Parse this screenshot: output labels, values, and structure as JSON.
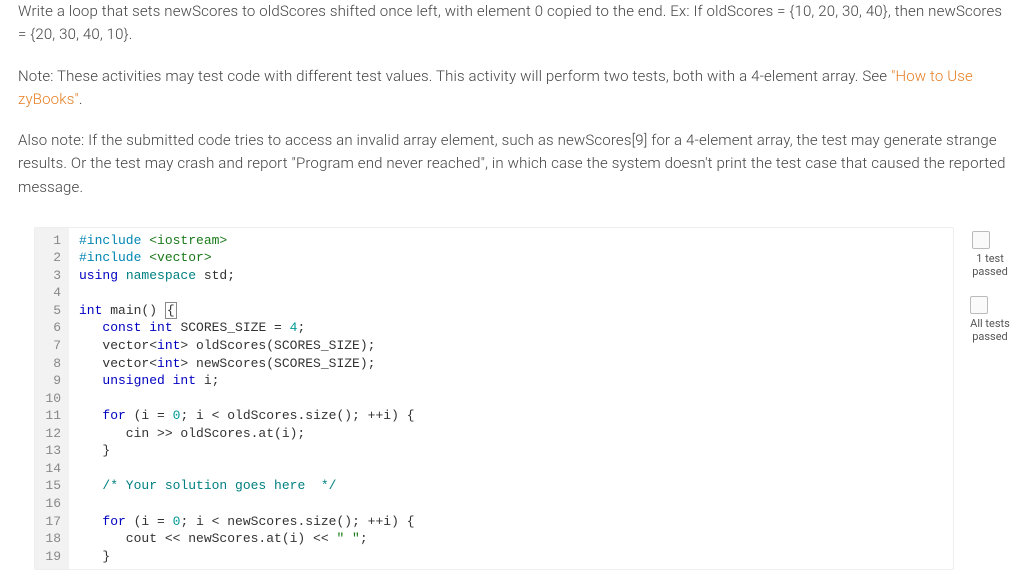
{
  "instructions": {
    "p1": "Write a loop that sets newScores to oldScores shifted once left, with element 0 copied to the end. Ex: If oldScores = {10, 20, 30, 40}, then newScores = {20, 30, 40, 10}.",
    "p2a": "Note: These activities may test code with different test values. This activity will perform two tests, both with a 4-element array. See ",
    "p2_link": "\"How to Use zyBooks\"",
    "p2b": ".",
    "p3": "Also note: If the submitted code tries to access an invalid array element, such as newScores[9] for a 4-element array, the test may generate strange results. Or the test may crash and report \"Program end never reached\", in which case the system doesn't print the test case that caused the reported message."
  },
  "code": {
    "lines": [
      {
        "n": 1,
        "tokens": [
          [
            "pp",
            "#include "
          ],
          [
            "str",
            "<iostream>"
          ]
        ]
      },
      {
        "n": 2,
        "tokens": [
          [
            "pp",
            "#include "
          ],
          [
            "str",
            "<vector>"
          ]
        ]
      },
      {
        "n": 3,
        "tokens": [
          [
            "kw",
            "using "
          ],
          [
            "ns",
            "namespace "
          ],
          [
            "id",
            "std;"
          ]
        ]
      },
      {
        "n": 4,
        "tokens": []
      },
      {
        "n": 5,
        "tokens": [
          [
            "type",
            "int "
          ],
          [
            "id",
            "main() "
          ],
          [
            "id",
            "{"
          ]
        ],
        "cursor_after_brace": true
      },
      {
        "n": 6,
        "tokens": [
          [
            "id",
            "   "
          ],
          [
            "kw",
            "const "
          ],
          [
            "type",
            "int "
          ],
          [
            "id",
            "SCORES_SIZE = "
          ],
          [
            "num",
            "4"
          ],
          [
            "id",
            ";"
          ]
        ]
      },
      {
        "n": 7,
        "tokens": [
          [
            "id",
            "   vector<"
          ],
          [
            "type",
            "int"
          ],
          [
            "id",
            "> oldScores(SCORES_SIZE);"
          ]
        ]
      },
      {
        "n": 8,
        "tokens": [
          [
            "id",
            "   vector<"
          ],
          [
            "type",
            "int"
          ],
          [
            "id",
            "> newScores(SCORES_SIZE);"
          ]
        ]
      },
      {
        "n": 9,
        "tokens": [
          [
            "id",
            "   "
          ],
          [
            "type",
            "unsigned int "
          ],
          [
            "id",
            "i;"
          ]
        ]
      },
      {
        "n": 10,
        "tokens": []
      },
      {
        "n": 11,
        "tokens": [
          [
            "id",
            "   "
          ],
          [
            "kw",
            "for "
          ],
          [
            "id",
            "(i = "
          ],
          [
            "num",
            "0"
          ],
          [
            "id",
            "; i < oldScores.size(); ++i) {"
          ]
        ]
      },
      {
        "n": 12,
        "tokens": [
          [
            "id",
            "      cin >> oldScores.at(i);"
          ]
        ]
      },
      {
        "n": 13,
        "tokens": [
          [
            "id",
            "   }"
          ]
        ]
      },
      {
        "n": 14,
        "tokens": []
      },
      {
        "n": 15,
        "tokens": [
          [
            "id",
            "   "
          ],
          [
            "cmt",
            "/* Your solution goes here  */"
          ]
        ]
      },
      {
        "n": 16,
        "tokens": []
      },
      {
        "n": 17,
        "tokens": [
          [
            "id",
            "   "
          ],
          [
            "kw",
            "for "
          ],
          [
            "id",
            "(i = "
          ],
          [
            "num",
            "0"
          ],
          [
            "id",
            "; i < newScores.size(); ++i) {"
          ]
        ]
      },
      {
        "n": 18,
        "tokens": [
          [
            "id",
            "      cout << newScores.at(i) << "
          ],
          [
            "str",
            "\" \""
          ],
          [
            "id",
            ";"
          ]
        ]
      },
      {
        "n": 19,
        "tokens": [
          [
            "id",
            "   }"
          ]
        ]
      }
    ]
  },
  "tests": {
    "item1": {
      "label_line1": "1 test",
      "label_line2": "passed",
      "checked": false
    },
    "item2": {
      "label_line1": "All tests",
      "label_line2": "passed",
      "checked": false
    }
  }
}
